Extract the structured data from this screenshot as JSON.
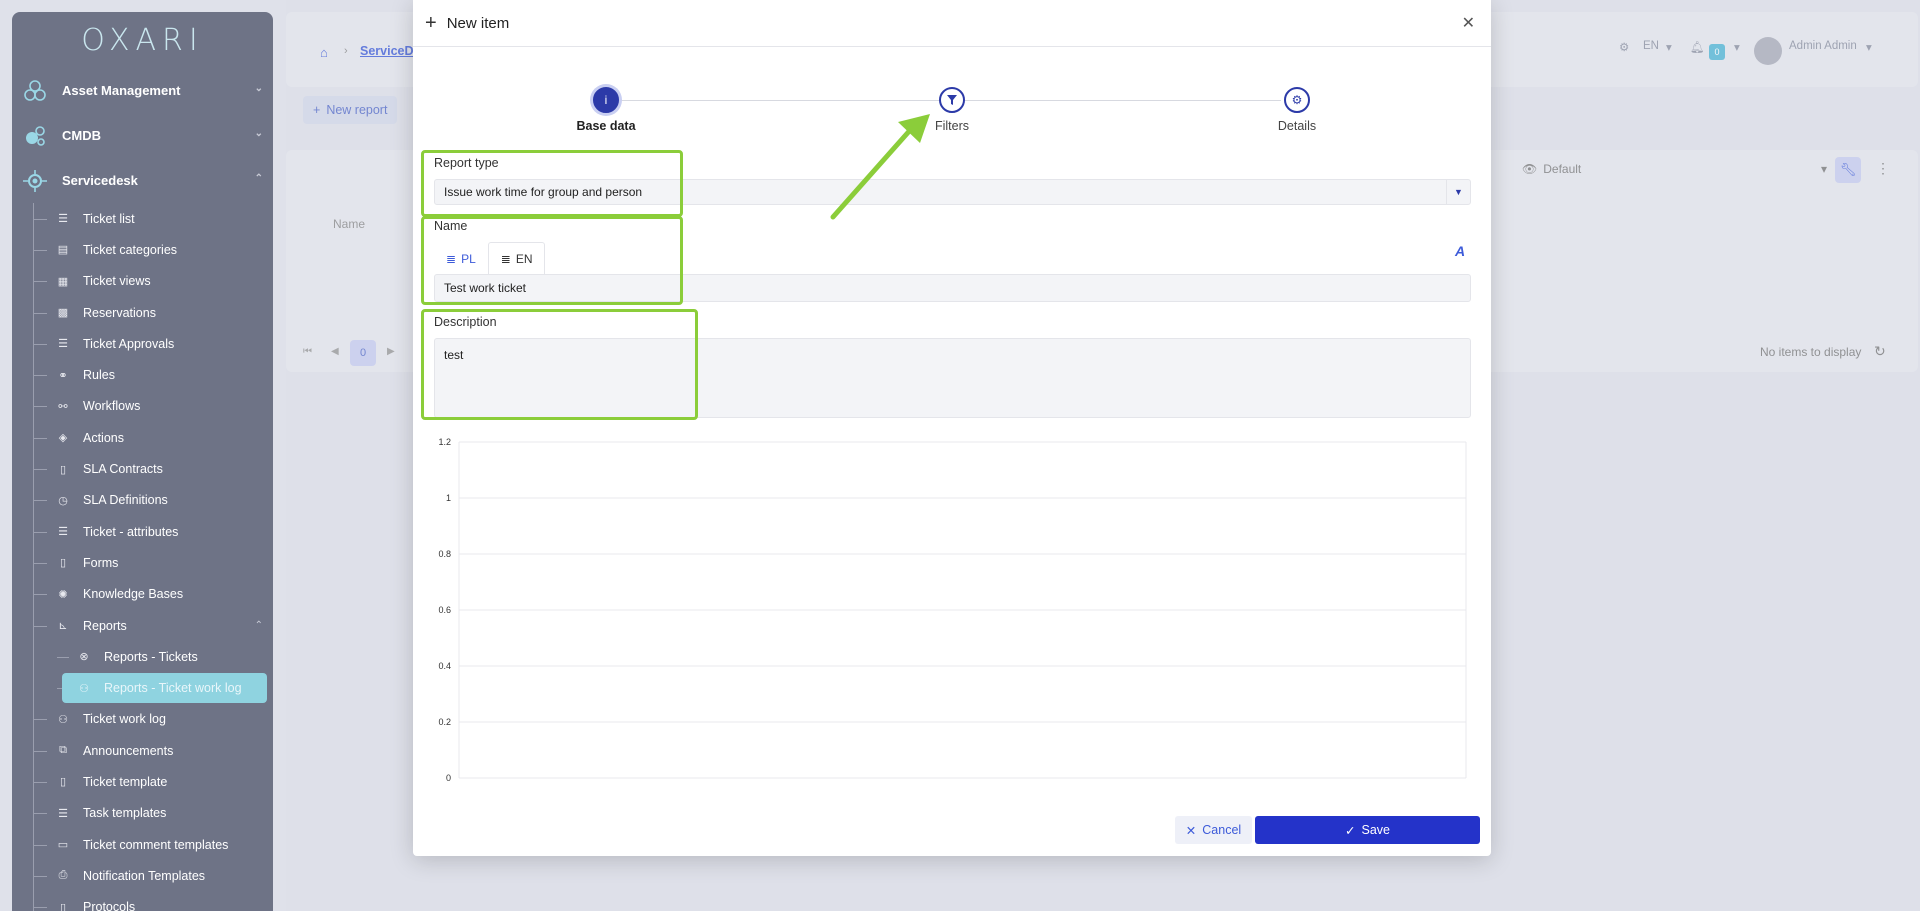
{
  "sidebar": {
    "logo": "OXARI",
    "groups": [
      {
        "label": "Asset Management",
        "icon": "asset-icon"
      },
      {
        "label": "CMDB",
        "icon": "cmdb-icon"
      },
      {
        "label": "Servicedesk",
        "icon": "servicedesk-icon"
      }
    ],
    "items": [
      {
        "label": "Ticket list",
        "icon": "list-icon"
      },
      {
        "label": "Ticket categories",
        "icon": "categories-icon"
      },
      {
        "label": "Ticket views",
        "icon": "table-icon"
      },
      {
        "label": "Reservations",
        "icon": "calendar-icon"
      },
      {
        "label": "Ticket Approvals",
        "icon": "list-icon"
      },
      {
        "label": "Rules",
        "icon": "rules-icon"
      },
      {
        "label": "Workflows",
        "icon": "workflow-icon"
      },
      {
        "label": "Actions",
        "icon": "actions-icon"
      },
      {
        "label": "SLA Contracts",
        "icon": "document-icon"
      },
      {
        "label": "SLA Definitions",
        "icon": "stopwatch-icon"
      },
      {
        "label": "Ticket - attributes",
        "icon": "list-icon"
      },
      {
        "label": "Forms",
        "icon": "document-icon"
      },
      {
        "label": "Knowledge Bases",
        "icon": "bulb-icon"
      },
      {
        "label": "Reports",
        "icon": "chart-icon"
      },
      {
        "label": "Reports - Tickets",
        "icon": "report-icon"
      },
      {
        "label": "Reports - Ticket work log",
        "icon": "user-clock-icon"
      },
      {
        "label": "Ticket work log",
        "icon": "user-clock-icon"
      },
      {
        "label": "Announcements",
        "icon": "announcement-icon"
      },
      {
        "label": "Ticket template",
        "icon": "document-icon"
      },
      {
        "label": "Task templates",
        "icon": "list-icon"
      },
      {
        "label": "Ticket comment templates",
        "icon": "comment-icon"
      },
      {
        "label": "Notification Templates",
        "icon": "notification-icon"
      },
      {
        "label": "Protocols",
        "icon": "document-icon"
      }
    ]
  },
  "topbar": {
    "breadcrumb": "ServiceD",
    "language": "EN",
    "notifications": "0",
    "user": "Admin Admin"
  },
  "page": {
    "new_report": "New report",
    "view": "Default",
    "column_name": "Name",
    "page_number": "0",
    "no_items": "No items to display"
  },
  "modal": {
    "title": "New item",
    "steps": [
      "Base data",
      "Filters",
      "Details"
    ],
    "report_type_label": "Report type",
    "report_type_value": "Issue work time for group and person",
    "name_label": "Name",
    "lang_tabs": [
      "PL",
      "EN"
    ],
    "name_value": "Test work ticket",
    "description_label": "Description",
    "description_value": "test",
    "cancel": "Cancel",
    "save": "Save"
  },
  "chart_data": {
    "type": "line",
    "title": "",
    "xlabel": "",
    "ylabel": "",
    "yticks": [
      "1.2",
      "1",
      "0.8",
      "0.6",
      "0.4",
      "0.2",
      "0"
    ],
    "ylim": [
      0,
      1.2
    ],
    "series": [],
    "grid": true
  },
  "colors": {
    "accent": "#2433c9",
    "highlight": "#8bcd3a",
    "sidebar": "#6e7386",
    "active_item": "#8fd3e0"
  }
}
